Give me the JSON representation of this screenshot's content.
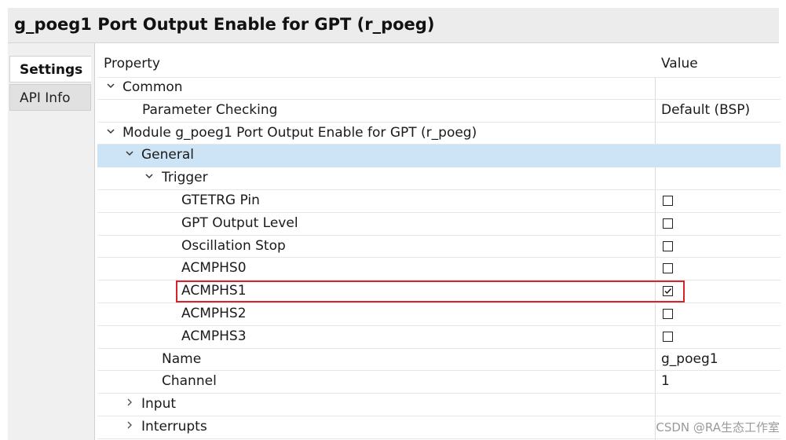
{
  "window": {
    "title": "g_poeg1 Port Output Enable for GPT (r_poeg)"
  },
  "tabs": [
    {
      "label": "Settings",
      "active": true
    },
    {
      "label": "API Info",
      "active": false
    }
  ],
  "table": {
    "headers": {
      "property": "Property",
      "value": "Value"
    },
    "rows": [
      {
        "label": "Common",
        "expander": "expanded",
        "value": ""
      },
      {
        "label": "Parameter Checking",
        "value": "Default (BSP)"
      },
      {
        "label": "Module g_poeg1 Port Output Enable for GPT (r_poeg)",
        "expander": "expanded",
        "value": ""
      },
      {
        "label": "General",
        "expander": "expanded",
        "value": "",
        "selected": true
      },
      {
        "label": "Trigger",
        "expander": "expanded",
        "value": ""
      },
      {
        "label": "GTETRG Pin",
        "checkbox": false
      },
      {
        "label": "GPT Output Level",
        "checkbox": false
      },
      {
        "label": "Oscillation Stop",
        "checkbox": false
      },
      {
        "label": "ACMPHS0",
        "checkbox": false
      },
      {
        "label": "ACMPHS1",
        "checkbox": true,
        "highlighted": true
      },
      {
        "label": "ACMPHS2",
        "checkbox": false
      },
      {
        "label": "ACMPHS3",
        "checkbox": false
      },
      {
        "label": "Name",
        "value": "g_poeg1"
      },
      {
        "label": "Channel",
        "value": "1"
      },
      {
        "label": "Input",
        "expander": "collapsed",
        "value": ""
      },
      {
        "label": "Interrupts",
        "expander": "collapsed",
        "value": ""
      }
    ]
  },
  "icons": {
    "expanded": "chevron-down-icon",
    "collapsed": "chevron-right-icon",
    "checked": "checkmark-icon"
  },
  "colors": {
    "selection": "#cde4f7",
    "highlight_border": "#d8232a"
  },
  "watermark": "CSDN @RA生态工作室"
}
